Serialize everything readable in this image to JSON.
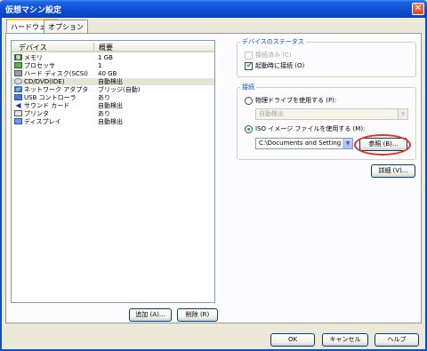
{
  "window": {
    "title": "仮想マシン設定"
  },
  "tabs": [
    {
      "label": "ハードウェア"
    },
    {
      "label": "オプション"
    }
  ],
  "device_list": {
    "headers": {
      "device": "デバイス",
      "summary": "概要"
    },
    "rows": [
      {
        "icon": "memory-icon",
        "name": "メモリ",
        "value": "1 GB"
      },
      {
        "icon": "processor-icon",
        "name": "プロセッサ",
        "value": "1"
      },
      {
        "icon": "hard-disk-icon",
        "name": "ハード ディスク(SCSI)",
        "value": "40 GB"
      },
      {
        "icon": "cd-dvd-icon",
        "name": "CD/DVD(IDE)",
        "value": "自動検出"
      },
      {
        "icon": "network-adapter-icon",
        "name": "ネットワーク アダプタ",
        "value": "ブリッジ(自動)"
      },
      {
        "icon": "usb-icon",
        "name": "USB コントローラ",
        "value": "あり"
      },
      {
        "icon": "sound-card-icon",
        "name": "サウンド カード",
        "value": "自動検出"
      },
      {
        "icon": "printer-icon",
        "name": "プリンタ",
        "value": "あり"
      },
      {
        "icon": "display-icon",
        "name": "ディスプレイ",
        "value": "自動検出"
      }
    ],
    "selected_index": 3
  },
  "list_buttons": {
    "add": "追加 (A)...",
    "remove": "削除 (R)"
  },
  "device_status": {
    "legend": "デバイスのステータス",
    "connected": {
      "label": "接続済み (C)",
      "checked": false,
      "disabled": true
    },
    "connect_at_power_on": {
      "label": "起動時に接続 (O)",
      "checked": true
    }
  },
  "connection": {
    "legend": "接続",
    "physical_drive": {
      "label": "物理ドライブを使用する (P):",
      "selected": false
    },
    "physical_drive_value": "自動検出",
    "iso_image": {
      "label": "ISO イメージ ファイルを使用する (M):",
      "selected": true
    },
    "iso_path": "C:\\Documents and Setting",
    "browse": "参照 (B)..."
  },
  "advanced_button": "詳細 (V)...",
  "footer": {
    "ok": "OK",
    "cancel": "キャンセル",
    "help": "ヘルプ"
  },
  "colors": {
    "accent": "#0046D5",
    "title_bar": "#0A4FD0",
    "highlight_ring": "#E8321E"
  }
}
